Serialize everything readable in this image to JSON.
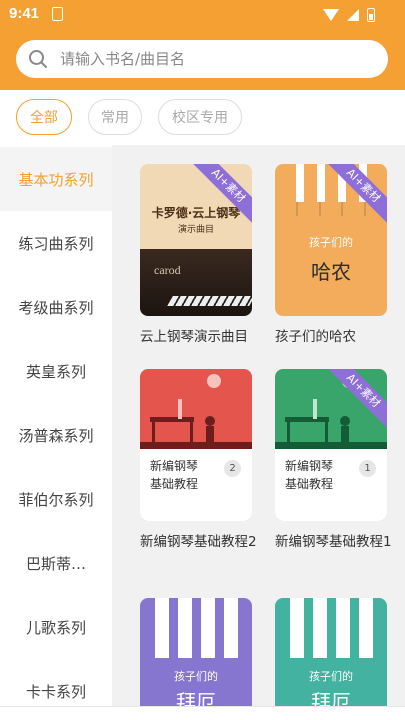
{
  "status_bar": {
    "time": "9:41"
  },
  "search": {
    "placeholder": "请输入书名/曲目名"
  },
  "filters": [
    {
      "label": "全部",
      "active": true
    },
    {
      "label": "常用",
      "active": false
    },
    {
      "label": "校区专用",
      "active": false
    }
  ],
  "sidebar": {
    "items": [
      {
        "label": "基本功系列",
        "active": true
      },
      {
        "label": "练习曲系列",
        "active": false
      },
      {
        "label": "考级曲系列",
        "active": false
      },
      {
        "label": "英皇系列",
        "active": false
      },
      {
        "label": "汤普森系列",
        "active": false
      },
      {
        "label": "菲伯尔系列",
        "active": false
      },
      {
        "label": "巴斯蒂…",
        "active": false
      },
      {
        "label": "儿歌系列",
        "active": false
      },
      {
        "label": "卡卡系列",
        "active": false
      }
    ]
  },
  "books": [
    {
      "title": "云上钢琴演示曲目",
      "badge": "AI+素材",
      "cover_title": "卡罗德·云上钢琴",
      "cover_subtitle": "演示曲目",
      "cover_brand": "carod",
      "cover_color": "#f1d9b6"
    },
    {
      "title": "孩子们的哈农",
      "badge": "AI+素材",
      "cover_title": "孩子们的",
      "cover_big": "哈农",
      "cover_color": "#f3ac5c"
    },
    {
      "title": "新编钢琴基础教程2",
      "badge": "",
      "cover_title": "新编钢琴",
      "cover_subtitle": "基础教程",
      "cover_num": "2",
      "cover_color": "#e4554e"
    },
    {
      "title": "新编钢琴基础教程1",
      "badge": "AI+素材",
      "cover_title": "新编钢琴",
      "cover_subtitle": "基础教程",
      "cover_num": "1",
      "cover_color": "#3aa56b"
    },
    {
      "title": "",
      "badge": "",
      "cover_title": "孩子们的",
      "cover_big": "拜厄",
      "cover_color": "#8676cf"
    },
    {
      "title": "",
      "badge": "",
      "cover_title": "孩子们的",
      "cover_big": "拜厄",
      "cover_color": "#43b2a0"
    }
  ]
}
